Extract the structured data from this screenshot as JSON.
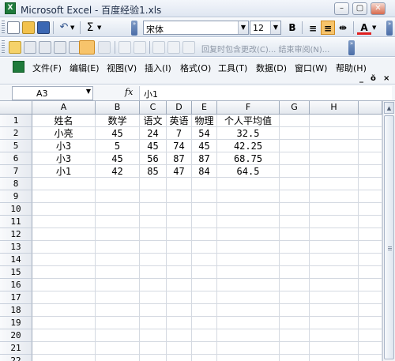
{
  "window": {
    "title": "Microsoft Excel - 百度经验1.xls",
    "app_icon": "X",
    "minimize": "–",
    "restore": "▢",
    "close": "✕"
  },
  "toolbar": {
    "sigma": "Σ",
    "font_name": "宋体",
    "font_size": "12",
    "bold": "B",
    "font_color_label": "A",
    "review_text": "回复时包含更改(C)... 结束审阅(N)...",
    "accent_orange": "#f0a33b"
  },
  "menu": {
    "items": [
      "文件(F)",
      "编辑(E)",
      "视图(V)",
      "插入(I)",
      "格式(O)",
      "工具(T)",
      "数据(D)",
      "窗口(W)",
      "帮助(H)"
    ],
    "mdi_min": "_",
    "mdi_restore": "ŏ",
    "mdi_close": "×"
  },
  "formula": {
    "name_box": "A3",
    "fx": "fx",
    "value": "小1"
  },
  "sheet": {
    "columns": [
      "A",
      "B",
      "C",
      "D",
      "E",
      "F",
      "G",
      "H"
    ],
    "rows": [
      {
        "num": "1",
        "cells": [
          "姓名",
          "数学",
          "语文",
          "英语",
          "物理",
          "个人平均值",
          "",
          ""
        ]
      },
      {
        "num": "2",
        "cells": [
          "小亮",
          "45",
          "24",
          "7",
          "54",
          "32.5",
          "",
          ""
        ]
      },
      {
        "num": "5",
        "cells": [
          "小3",
          "5",
          "45",
          "74",
          "45",
          "42.25",
          "",
          ""
        ]
      },
      {
        "num": "6",
        "cells": [
          "小3",
          "45",
          "56",
          "87",
          "87",
          "68.75",
          "",
          ""
        ]
      },
      {
        "num": "7",
        "cells": [
          "小1",
          "42",
          "85",
          "47",
          "84",
          "64.5",
          "",
          ""
        ]
      },
      {
        "num": "8",
        "cells": [
          "",
          "",
          "",
          "",
          "",
          "",
          "",
          ""
        ]
      },
      {
        "num": "9",
        "cells": [
          "",
          "",
          "",
          "",
          "",
          "",
          "",
          ""
        ]
      },
      {
        "num": "10",
        "cells": [
          "",
          "",
          "",
          "",
          "",
          "",
          "",
          ""
        ]
      },
      {
        "num": "11",
        "cells": [
          "",
          "",
          "",
          "",
          "",
          "",
          "",
          ""
        ]
      },
      {
        "num": "12",
        "cells": [
          "",
          "",
          "",
          "",
          "",
          "",
          "",
          ""
        ]
      },
      {
        "num": "13",
        "cells": [
          "",
          "",
          "",
          "",
          "",
          "",
          "",
          ""
        ]
      },
      {
        "num": "14",
        "cells": [
          "",
          "",
          "",
          "",
          "",
          "",
          "",
          ""
        ]
      },
      {
        "num": "15",
        "cells": [
          "",
          "",
          "",
          "",
          "",
          "",
          "",
          ""
        ]
      },
      {
        "num": "16",
        "cells": [
          "",
          "",
          "",
          "",
          "",
          "",
          "",
          ""
        ]
      },
      {
        "num": "17",
        "cells": [
          "",
          "",
          "",
          "",
          "",
          "",
          "",
          ""
        ]
      },
      {
        "num": "18",
        "cells": [
          "",
          "",
          "",
          "",
          "",
          "",
          "",
          ""
        ]
      },
      {
        "num": "19",
        "cells": [
          "",
          "",
          "",
          "",
          "",
          "",
          "",
          ""
        ]
      },
      {
        "num": "20",
        "cells": [
          "",
          "",
          "",
          "",
          "",
          "",
          "",
          ""
        ]
      },
      {
        "num": "21",
        "cells": [
          "",
          "",
          "",
          "",
          "",
          "",
          "",
          ""
        ]
      },
      {
        "num": "22",
        "cells": [
          "",
          "",
          "",
          "",
          "",
          "",
          "",
          ""
        ]
      }
    ],
    "gridline_color": "#d4d9e1",
    "header_border_color": "#9eaabb"
  }
}
